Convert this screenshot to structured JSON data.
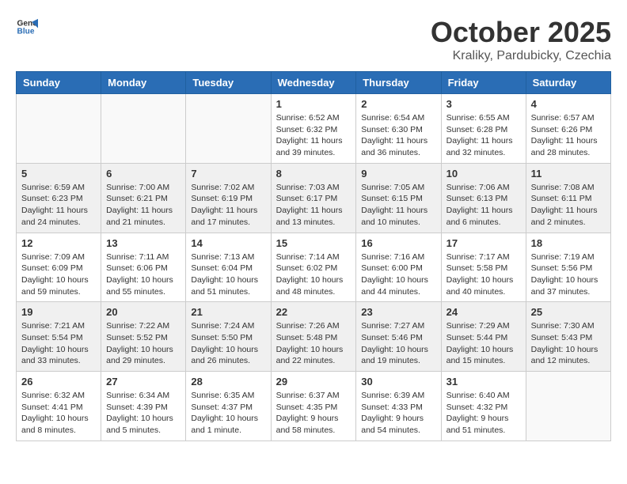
{
  "header": {
    "logo_line1": "General",
    "logo_line2": "Blue",
    "month": "October 2025",
    "location": "Kraliky, Pardubicky, Czechia"
  },
  "weekdays": [
    "Sunday",
    "Monday",
    "Tuesday",
    "Wednesday",
    "Thursday",
    "Friday",
    "Saturday"
  ],
  "weeks": [
    [
      {
        "day": "",
        "info": ""
      },
      {
        "day": "",
        "info": ""
      },
      {
        "day": "",
        "info": ""
      },
      {
        "day": "1",
        "info": "Sunrise: 6:52 AM\nSunset: 6:32 PM\nDaylight: 11 hours\nand 39 minutes."
      },
      {
        "day": "2",
        "info": "Sunrise: 6:54 AM\nSunset: 6:30 PM\nDaylight: 11 hours\nand 36 minutes."
      },
      {
        "day": "3",
        "info": "Sunrise: 6:55 AM\nSunset: 6:28 PM\nDaylight: 11 hours\nand 32 minutes."
      },
      {
        "day": "4",
        "info": "Sunrise: 6:57 AM\nSunset: 6:26 PM\nDaylight: 11 hours\nand 28 minutes."
      }
    ],
    [
      {
        "day": "5",
        "info": "Sunrise: 6:59 AM\nSunset: 6:23 PM\nDaylight: 11 hours\nand 24 minutes."
      },
      {
        "day": "6",
        "info": "Sunrise: 7:00 AM\nSunset: 6:21 PM\nDaylight: 11 hours\nand 21 minutes."
      },
      {
        "day": "7",
        "info": "Sunrise: 7:02 AM\nSunset: 6:19 PM\nDaylight: 11 hours\nand 17 minutes."
      },
      {
        "day": "8",
        "info": "Sunrise: 7:03 AM\nSunset: 6:17 PM\nDaylight: 11 hours\nand 13 minutes."
      },
      {
        "day": "9",
        "info": "Sunrise: 7:05 AM\nSunset: 6:15 PM\nDaylight: 11 hours\nand 10 minutes."
      },
      {
        "day": "10",
        "info": "Sunrise: 7:06 AM\nSunset: 6:13 PM\nDaylight: 11 hours\nand 6 minutes."
      },
      {
        "day": "11",
        "info": "Sunrise: 7:08 AM\nSunset: 6:11 PM\nDaylight: 11 hours\nand 2 minutes."
      }
    ],
    [
      {
        "day": "12",
        "info": "Sunrise: 7:09 AM\nSunset: 6:09 PM\nDaylight: 10 hours\nand 59 minutes."
      },
      {
        "day": "13",
        "info": "Sunrise: 7:11 AM\nSunset: 6:06 PM\nDaylight: 10 hours\nand 55 minutes."
      },
      {
        "day": "14",
        "info": "Sunrise: 7:13 AM\nSunset: 6:04 PM\nDaylight: 10 hours\nand 51 minutes."
      },
      {
        "day": "15",
        "info": "Sunrise: 7:14 AM\nSunset: 6:02 PM\nDaylight: 10 hours\nand 48 minutes."
      },
      {
        "day": "16",
        "info": "Sunrise: 7:16 AM\nSunset: 6:00 PM\nDaylight: 10 hours\nand 44 minutes."
      },
      {
        "day": "17",
        "info": "Sunrise: 7:17 AM\nSunset: 5:58 PM\nDaylight: 10 hours\nand 40 minutes."
      },
      {
        "day": "18",
        "info": "Sunrise: 7:19 AM\nSunset: 5:56 PM\nDaylight: 10 hours\nand 37 minutes."
      }
    ],
    [
      {
        "day": "19",
        "info": "Sunrise: 7:21 AM\nSunset: 5:54 PM\nDaylight: 10 hours\nand 33 minutes."
      },
      {
        "day": "20",
        "info": "Sunrise: 7:22 AM\nSunset: 5:52 PM\nDaylight: 10 hours\nand 29 minutes."
      },
      {
        "day": "21",
        "info": "Sunrise: 7:24 AM\nSunset: 5:50 PM\nDaylight: 10 hours\nand 26 minutes."
      },
      {
        "day": "22",
        "info": "Sunrise: 7:26 AM\nSunset: 5:48 PM\nDaylight: 10 hours\nand 22 minutes."
      },
      {
        "day": "23",
        "info": "Sunrise: 7:27 AM\nSunset: 5:46 PM\nDaylight: 10 hours\nand 19 minutes."
      },
      {
        "day": "24",
        "info": "Sunrise: 7:29 AM\nSunset: 5:44 PM\nDaylight: 10 hours\nand 15 minutes."
      },
      {
        "day": "25",
        "info": "Sunrise: 7:30 AM\nSunset: 5:43 PM\nDaylight: 10 hours\nand 12 minutes."
      }
    ],
    [
      {
        "day": "26",
        "info": "Sunrise: 6:32 AM\nSunset: 4:41 PM\nDaylight: 10 hours\nand 8 minutes."
      },
      {
        "day": "27",
        "info": "Sunrise: 6:34 AM\nSunset: 4:39 PM\nDaylight: 10 hours\nand 5 minutes."
      },
      {
        "day": "28",
        "info": "Sunrise: 6:35 AM\nSunset: 4:37 PM\nDaylight: 10 hours\nand 1 minute."
      },
      {
        "day": "29",
        "info": "Sunrise: 6:37 AM\nSunset: 4:35 PM\nDaylight: 9 hours\nand 58 minutes."
      },
      {
        "day": "30",
        "info": "Sunrise: 6:39 AM\nSunset: 4:33 PM\nDaylight: 9 hours\nand 54 minutes."
      },
      {
        "day": "31",
        "info": "Sunrise: 6:40 AM\nSunset: 4:32 PM\nDaylight: 9 hours\nand 51 minutes."
      },
      {
        "day": "",
        "info": ""
      }
    ]
  ]
}
